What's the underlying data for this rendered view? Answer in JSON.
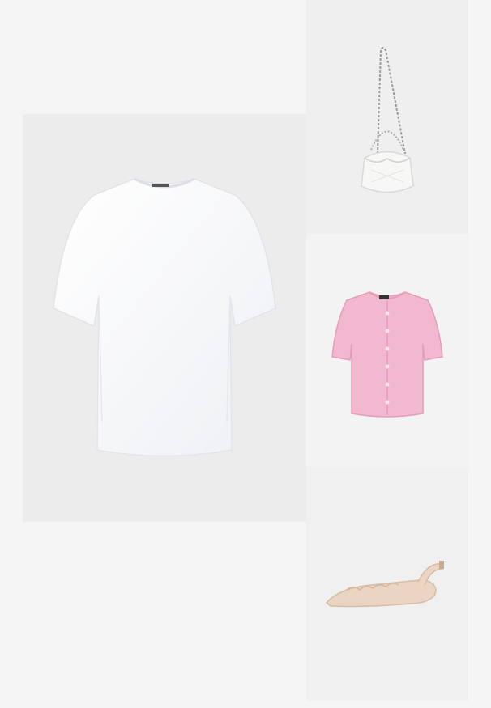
{
  "collage": {
    "items": [
      {
        "name": "white-oversized-tshirt",
        "color": "#ffffff"
      },
      {
        "name": "white-bucket-bag",
        "color": "#f7f7f5"
      },
      {
        "name": "pink-knit-cardigan",
        "color": "#f2b8cf"
      },
      {
        "name": "nude-ankle-strap-flats",
        "color": "#e8d2bf"
      }
    ],
    "background": "#f5f5f5"
  }
}
